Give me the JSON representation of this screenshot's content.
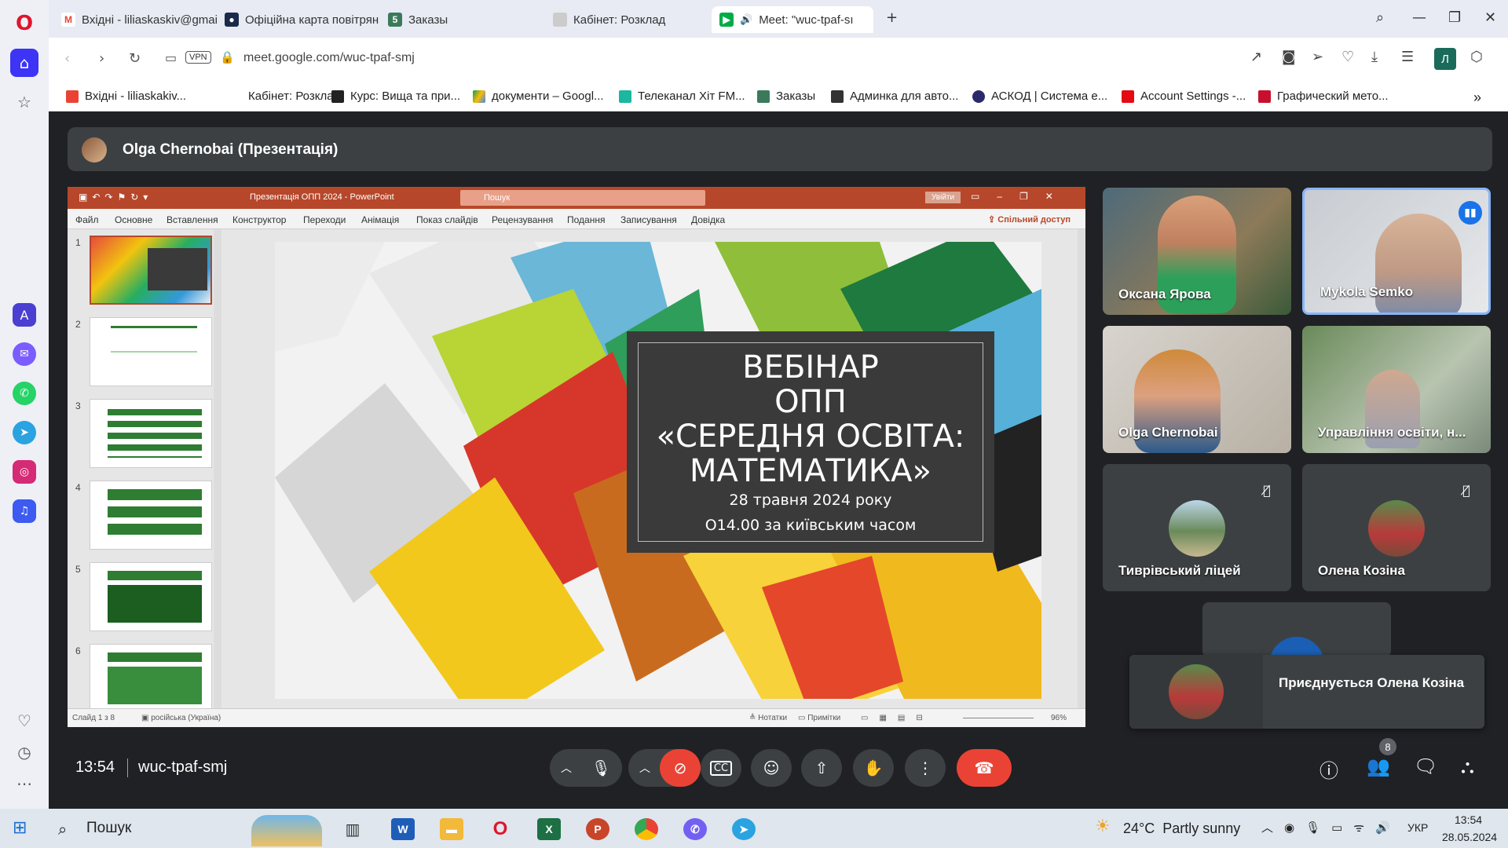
{
  "browser": {
    "tabs": [
      {
        "label": "Вхідні - liliaskaskiv@gmai"
      },
      {
        "label": "Офіційна карта повітряні"
      },
      {
        "label": "Заказы"
      },
      {
        "label": "Кабінет: Розклад"
      },
      {
        "label": "Meet: \"wuc-tpaf-sı"
      }
    ],
    "url": "meet.google.com/wuc-tpaf-smj",
    "vpn_label": "VPN",
    "profile_initial": "Л",
    "bookmarks": [
      {
        "label": "Вхідні - liliaskakiv..."
      },
      {
        "label": "Кабінет: Розклад"
      },
      {
        "label": "Курс: Вища та при..."
      },
      {
        "label": "документи – Googl..."
      },
      {
        "label": "Телеканал Хіт FM..."
      },
      {
        "label": "Заказы"
      },
      {
        "label": "Админка для авто..."
      },
      {
        "label": "АСКОД | Система е..."
      },
      {
        "label": "Account Settings -..."
      },
      {
        "label": "Графический мето..."
      }
    ]
  },
  "meet": {
    "presenter": "Olga Chernobai (Презентація)",
    "time": "13:54",
    "meeting_code": "wuc-tpaf-smj",
    "people_count": "8",
    "participants": [
      {
        "name": "Оксана Ярова"
      },
      {
        "name": "Mykola Semko"
      },
      {
        "name": "Olga Chernobai"
      },
      {
        "name": "Управління освіти, н..."
      },
      {
        "name": "Тиврівський ліцей"
      },
      {
        "name": "Олена Козіна"
      }
    ],
    "toast": "Приєднується Олена Козіна"
  },
  "ppt": {
    "title": "Презентація ОПП 2024  -  PowerPoint",
    "search_placeholder": "Пошук",
    "signin": "Увійти",
    "share": "Спільний доступ",
    "ribbon": [
      "Файл",
      "Основне",
      "Вставлення",
      "Конструктор",
      "Переходи",
      "Анімація",
      "Показ слайдів",
      "Рецензування",
      "Подання",
      "Записування",
      "Довідка"
    ],
    "thumb_numbers": [
      "1",
      "2",
      "3",
      "4",
      "5",
      "6"
    ],
    "slide": {
      "line1": "ВЕБІНАР",
      "line2": "ОПП",
      "line3": "«СЕРЕДНЯ ОСВІТА:",
      "line4": "МАТЕМАТИКА»",
      "date": "28 травня 2024 року",
      "time": "О14.00 за київським часом"
    },
    "status_slide": "Слайд 1 з 8",
    "status_lang": "російська (Україна)",
    "status_notes": "Нотатки",
    "status_comments": "Примітки",
    "zoom": "96%"
  },
  "taskbar": {
    "search": "Пошук",
    "weather": "24°C  Partly sunny",
    "lang": "УКР",
    "time": "13:54",
    "date": "28.05.2024"
  }
}
